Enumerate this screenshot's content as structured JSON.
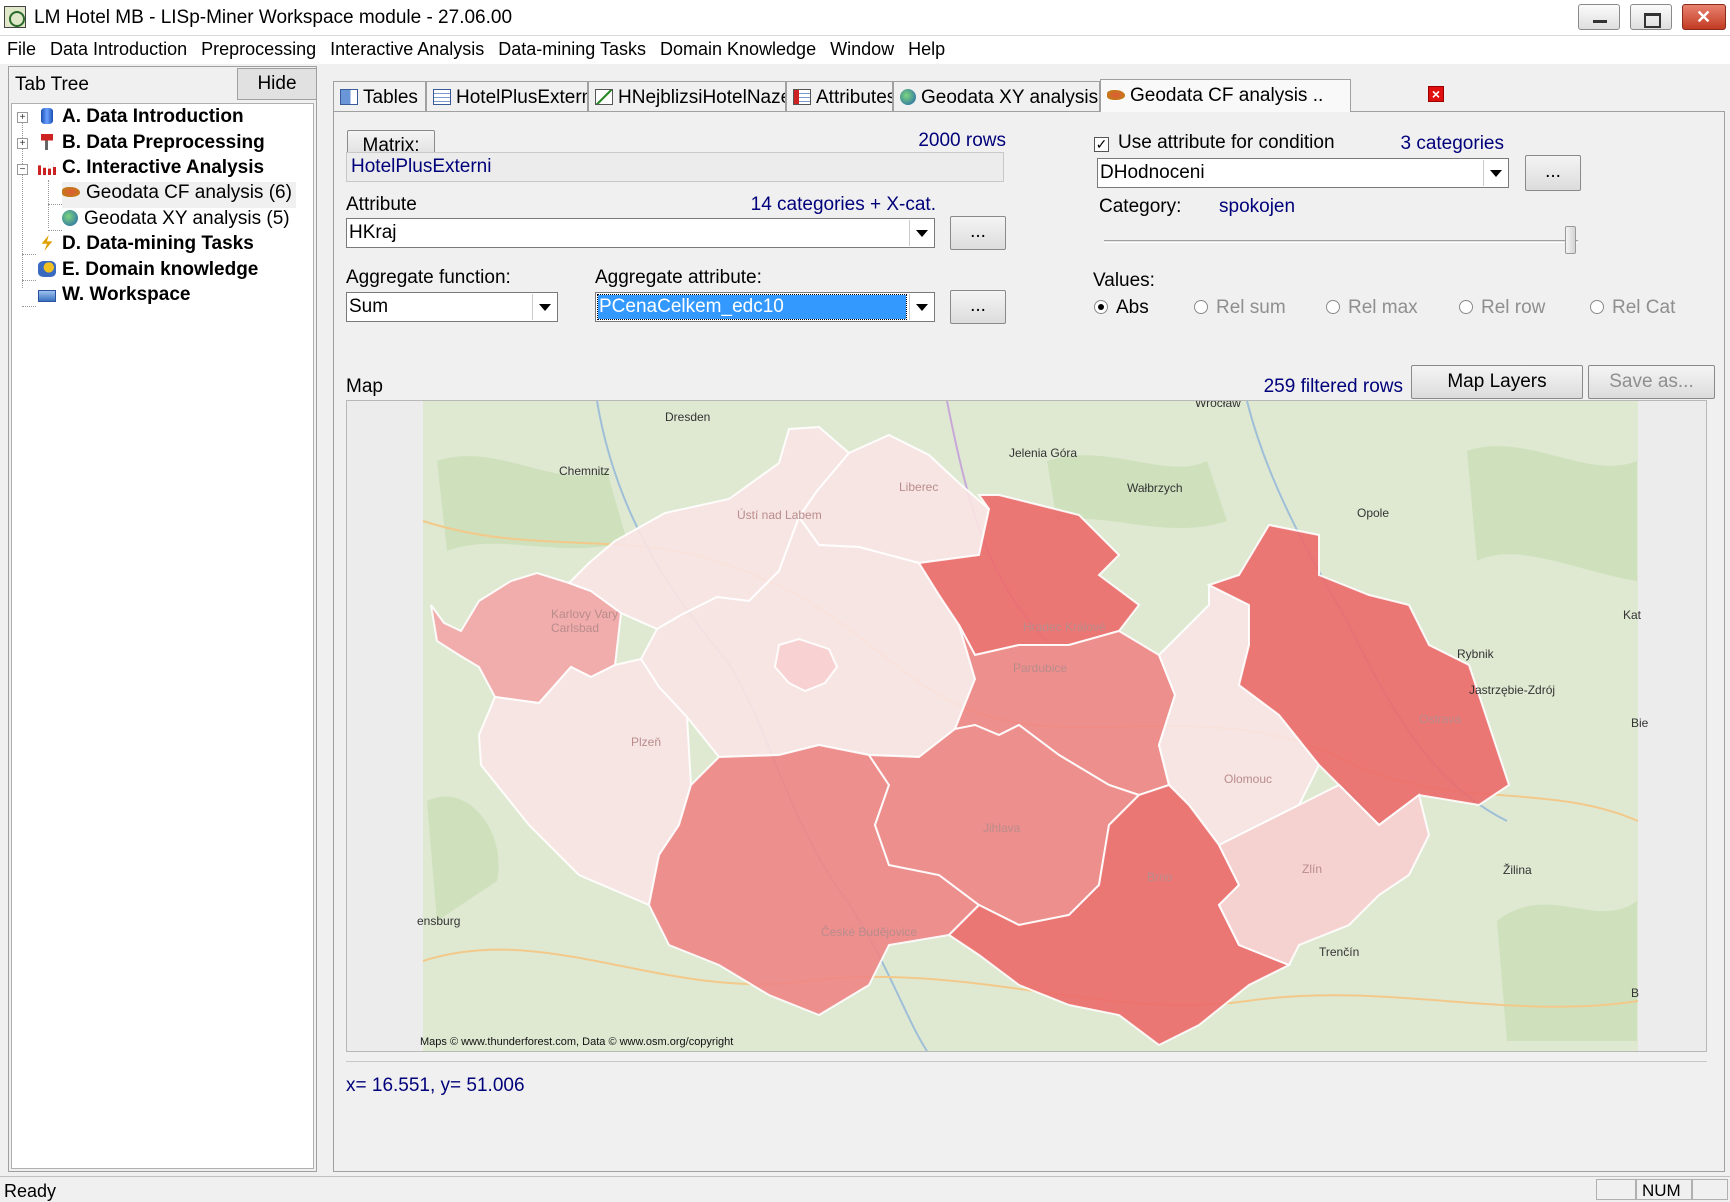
{
  "window": {
    "title": "LM Hotel MB - LISp-Miner Workspace module - 27.06.00"
  },
  "menu": [
    "File",
    "Data Introduction",
    "Preprocessing",
    "Interactive Analysis",
    "Data-mining Tasks",
    "Domain Knowledge",
    "Window",
    "Help"
  ],
  "left_pane": {
    "title": "Tab Tree",
    "hide_label": "Hide",
    "tree": [
      {
        "label": "A. Data Introduction"
      },
      {
        "label": "B. Data Preprocessing"
      },
      {
        "label": "C. Interactive Analysis"
      },
      {
        "label": "Geodata CF analysis (6)"
      },
      {
        "label": "Geodata XY analysis (5)"
      },
      {
        "label": "D. Data-mining Tasks"
      },
      {
        "label": "E. Domain knowledge"
      },
      {
        "label": "W. Workspace"
      }
    ]
  },
  "tabs": [
    "Tables",
    "HotelPlusExterni",
    "HNejblizsiHotelNazev",
    "Attributes",
    "Geodata XY analysis ..",
    "Geodata CF analysis .."
  ],
  "form": {
    "matrix_label": "Matrix:",
    "matrix_rows": "2000 rows",
    "matrix_value": "HotelPlusExterni",
    "attribute_label": "Attribute",
    "attribute_categories": "14 categories + X-cat.",
    "attribute_value": "HKraj",
    "ellipsis": "...",
    "aggfunc_label": "Aggregate function:",
    "aggfunc_value": "Sum",
    "aggattr_label": "Aggregate attribute:",
    "aggattr_value": "PCenaCelkem_edc10",
    "use_condition_label": "Use attribute for condition",
    "condition_categories": "3 categories",
    "condition_value": "DHodnoceni",
    "category_label": "Category:",
    "category_value": "spokojen",
    "values_label": "Values:",
    "radios": [
      "Abs",
      "Rel sum",
      "Rel max",
      "Rel row",
      "Rel Cat"
    ],
    "map_label": "Map",
    "filtered_rows": "259 filtered rows",
    "map_layers_label": "Map Layers",
    "save_as_label": "Save as..."
  },
  "map": {
    "labels": [
      "Dresden",
      "Wrocław",
      "Chemnitz",
      "Jelenia Góra",
      "Liberec",
      "Wałbrzych",
      "Opole",
      "Ústí nad Labem",
      "Karlovy Vary",
      "Carlsbad",
      "Hradec Králové",
      "Pardubice",
      "Rybnik",
      "Jastrzębie-Zdrój",
      "Ostrava",
      "Plzeň",
      "Olomouc",
      "Jihlava",
      "Brno",
      "Zlín",
      "Žilina",
      "České Budějovice",
      "Trenčín",
      "ensburg",
      "Kat",
      "Bie",
      "B"
    ],
    "attribution": "Maps © www.thunderforest.com, Data © www.osm.org/copyright",
    "colors": {
      "lightest": "#f9e4e4",
      "light": "#f7cfcf",
      "medium": "#f3a6a6",
      "strong": "#ee8585",
      "strongest": "#ec6a6a"
    }
  },
  "coordinates": "x= 16.551, y= 51.006",
  "status": {
    "text": "Ready",
    "num": "NUM"
  }
}
